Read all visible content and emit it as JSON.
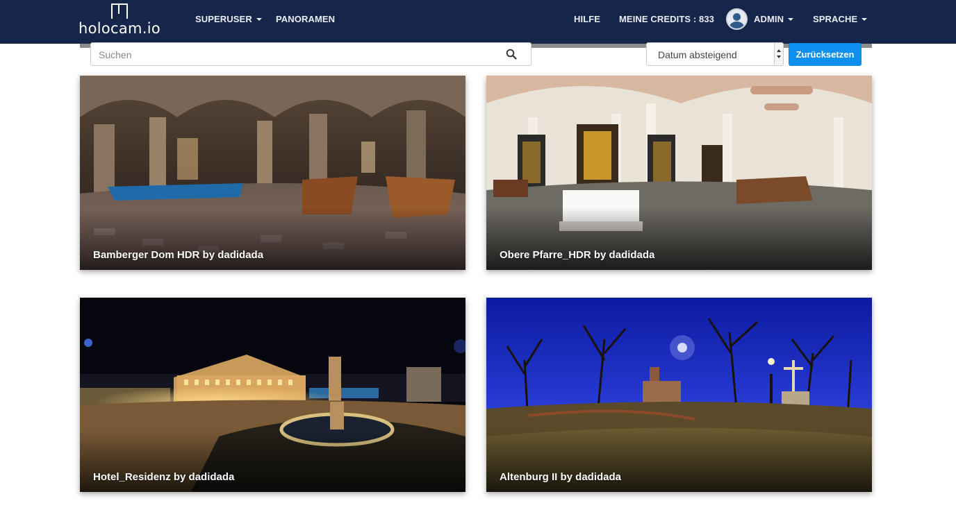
{
  "brand": {
    "logo_text": "holocam.io"
  },
  "nav": {
    "superuser": "SUPERUSER",
    "panoramen": "PANORAMEN",
    "hilfe": "HILFE",
    "credits": "MEINE CREDITS : 833",
    "admin": "ADMIN",
    "sprache": "SPRACHE"
  },
  "toolbar": {
    "search_placeholder": "Suchen",
    "sort_selected": "Datum absteigend",
    "reset_label": "Zurücksetzen"
  },
  "colors": {
    "navbar": "#16264a",
    "accent": "#0d8ff0"
  },
  "panoramas": [
    {
      "title": "Bamberger Dom HDR by dadidada"
    },
    {
      "title": "Obere Pfarre_HDR by dadidada"
    },
    {
      "title": "Hotel_Residenz by dadidada"
    },
    {
      "title": "Altenburg II by dadidada"
    }
  ]
}
